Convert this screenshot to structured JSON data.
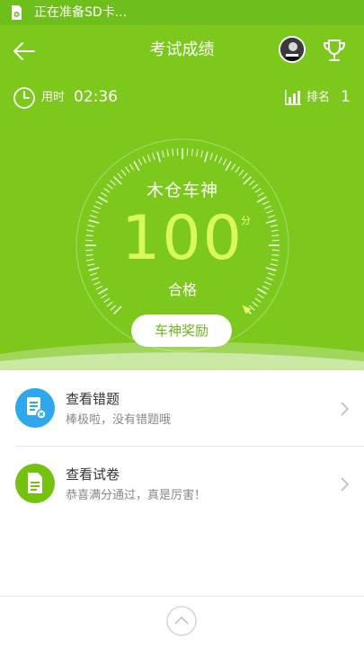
{
  "status_bar": {
    "text": "正在准备SD卡..."
  },
  "header": {
    "title": "考试成绩"
  },
  "stats": {
    "time_label": "用时",
    "time_value": "02:36",
    "rank_label": "排名",
    "rank_value": "1"
  },
  "result": {
    "user_name": "木仓车神",
    "score": "100",
    "score_unit": "分",
    "result_text": "合格",
    "reward_button": "车神奖励",
    "gauge_fraction": 1.0
  },
  "list": {
    "items": [
      {
        "title": "查看错题",
        "desc": "棒极啦，没有错题哦"
      },
      {
        "title": "查看试卷",
        "desc": "恭喜满分通过，真是厉害！"
      }
    ]
  },
  "colors": {
    "brand_green": "#7cc81d",
    "score_yellow": "#d9f85c",
    "wrong_icon_blue": "#2ea7ec",
    "paper_icon_green": "#74c20f"
  },
  "icons": {
    "back": "back-arrow-icon",
    "trophy": "trophy-icon",
    "clock": "clock-icon",
    "rank": "bar-chart-icon",
    "wrong": "wrong-questions-icon",
    "paper": "document-icon",
    "up": "chevron-up-icon"
  }
}
